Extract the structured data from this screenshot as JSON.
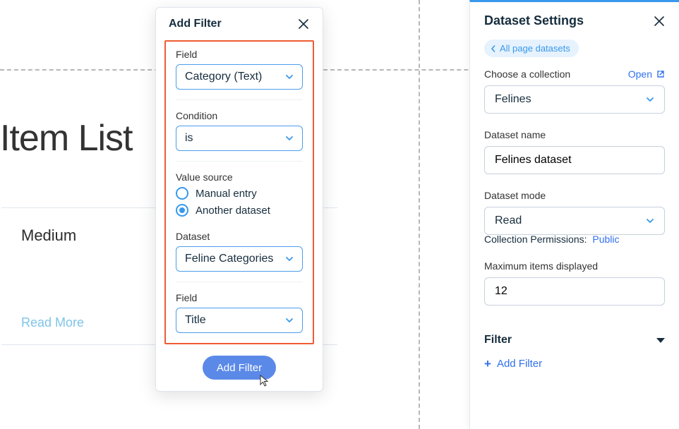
{
  "canvas": {
    "itemListTitle": "Item List",
    "card": {
      "title": "Medium",
      "link": "Read More"
    }
  },
  "dialog": {
    "title": "Add Filter",
    "fieldLabel": "Field",
    "fieldValue": "Category (Text)",
    "conditionLabel": "Condition",
    "conditionValue": "is",
    "valueSourceLabel": "Value source",
    "valueSourceOptions": {
      "manual": "Manual entry",
      "anotherDataset": "Another dataset"
    },
    "valueSourceSelected": "anotherDataset",
    "datasetLabel": "Dataset",
    "datasetValue": "Feline Categories",
    "field2Label": "Field",
    "field2Value": "Title",
    "addButton": "Add Filter"
  },
  "settings": {
    "title": "Dataset Settings",
    "backChip": "All page datasets",
    "collectionLabel": "Choose a collection",
    "openLink": "Open",
    "collectionValue": "Felines",
    "datasetNameLabel": "Dataset name",
    "datasetNameValue": "Felines dataset",
    "datasetModeLabel": "Dataset mode",
    "datasetModeValue": "Read",
    "collectionPermissionsLabel": "Collection Permissions:",
    "collectionPermissionsValue": "Public",
    "maxItemsLabel": "Maximum items displayed",
    "maxItemsValue": "12",
    "filterHeader": "Filter",
    "addFilterLink": "Add Filter"
  }
}
